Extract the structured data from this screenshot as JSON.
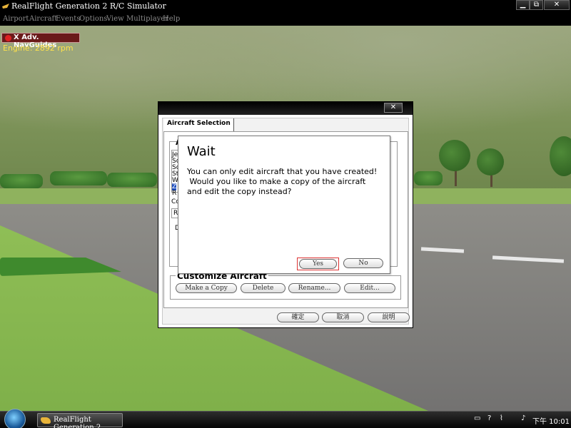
{
  "window": {
    "title": "RealFlight Generation 2 R/C Simulator",
    "min_glyph": "▁",
    "max_glyph": "⧉",
    "close_glyph": "✕"
  },
  "menu": [
    "Airport",
    "Aircraft",
    "Events",
    "Options",
    "View",
    "Multiplayer",
    "Help"
  ],
  "hud": {
    "navguides_label": "X Adv. NavGuides",
    "engine_label": "Engine: 2892 rpm"
  },
  "aircraft_dialog": {
    "close_glyph": "✕",
    "tab_label": "Aircraft Selection",
    "partial_labels": [
      "A",
      "Je",
      "Sc",
      "Sc",
      "St",
      "W",
      "Z",
      "R",
      "Co",
      "R",
      "D"
    ],
    "customize_title": "Customize Aircraft",
    "buttons": {
      "make_copy": "Make a Copy",
      "delete": "Delete",
      "rename": "Rename...",
      "edit": "Edit..."
    },
    "footer": {
      "ok": "確定",
      "cancel": "取消",
      "help": "說明"
    }
  },
  "wait_dialog": {
    "title": "Wait",
    "message": "You can only edit aircraft that you have created!\n Would you like to make a copy of the aircraft\nand edit the copy instead?",
    "yes": "Yes",
    "no": "No"
  },
  "taskbar": {
    "task_label": "RealFlight Generation 2...",
    "clock": "下午 10:01",
    "colors": {
      "accent": "#e8b43a"
    }
  }
}
